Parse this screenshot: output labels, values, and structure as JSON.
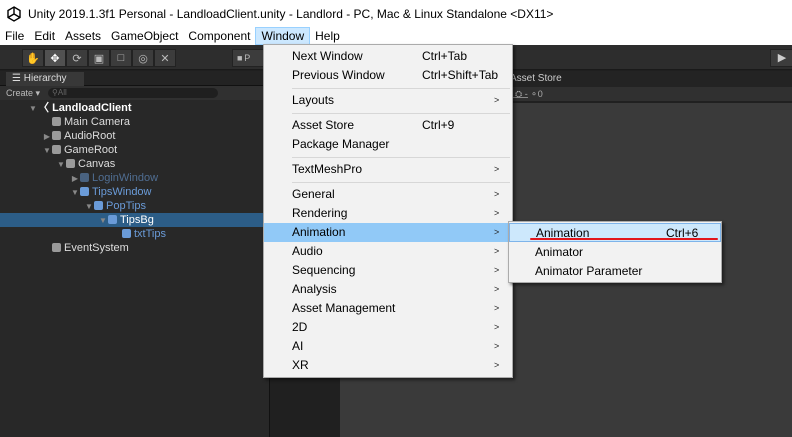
{
  "titlebar": {
    "title": "Unity 2019.1.3f1 Personal - LandloadClient.unity - Landlord - PC, Mac & Linux Standalone <DX11>"
  },
  "menubar": {
    "items": [
      "File",
      "Edit",
      "Assets",
      "GameObject",
      "Component",
      "Window",
      "Help"
    ],
    "active": "Window"
  },
  "toolbar": {
    "tools": [
      "hand-icon",
      "move-icon",
      "rotate-icon",
      "scale-icon",
      "rect-icon",
      "transform-icon",
      "custom-tool-icon"
    ],
    "active_tool": "move-icon",
    "pivot_label": "P",
    "play_icon": "play-icon"
  },
  "hierarchy": {
    "tab_label": "Hierarchy",
    "create_label": "Create",
    "search_placeholder": "All",
    "rows": [
      {
        "label": "LandloadClient",
        "depth": 1,
        "expanded": true,
        "kind": "scene"
      },
      {
        "label": "Main Camera",
        "depth": 2,
        "kind": "object"
      },
      {
        "label": "AudioRoot",
        "depth": 2,
        "expanded": false,
        "kind": "object"
      },
      {
        "label": "GameRoot",
        "depth": 2,
        "expanded": true,
        "kind": "object"
      },
      {
        "label": "Canvas",
        "depth": 3,
        "expanded": true,
        "kind": "object"
      },
      {
        "label": "LoginWindow",
        "depth": 4,
        "expanded": false,
        "kind": "prefab-inactive"
      },
      {
        "label": "TipsWindow",
        "depth": 4,
        "expanded": true,
        "kind": "prefab"
      },
      {
        "label": "PopTips",
        "depth": 5,
        "expanded": true,
        "kind": "prefab"
      },
      {
        "label": "TipsBg",
        "depth": 6,
        "expanded": true,
        "kind": "prefab",
        "selected": true
      },
      {
        "label": "txtTips",
        "depth": 7,
        "kind": "prefab"
      },
      {
        "label": "EventSystem",
        "depth": 2,
        "kind": "object"
      }
    ]
  },
  "scene": {
    "asset_store_tab": "Asset Store",
    "toolbar_text": "▸ ⛭ - ⚬0"
  },
  "window_menu": {
    "items": [
      {
        "label": "Next Window",
        "shortcut": "Ctrl+Tab"
      },
      {
        "label": "Previous Window",
        "shortcut": "Ctrl+Shift+Tab"
      },
      {
        "label": "Layouts",
        "submenu": true
      },
      {
        "label": "Asset Store",
        "shortcut": "Ctrl+9"
      },
      {
        "label": "Package Manager"
      },
      {
        "label": "TextMeshPro",
        "submenu": true
      },
      {
        "label": "General",
        "submenu": true
      },
      {
        "label": "Rendering",
        "submenu": true
      },
      {
        "label": "Animation",
        "submenu": true,
        "highlighted": true
      },
      {
        "label": "Audio",
        "submenu": true
      },
      {
        "label": "Sequencing",
        "submenu": true
      },
      {
        "label": "Analysis",
        "submenu": true
      },
      {
        "label": "Asset Management",
        "submenu": true
      },
      {
        "label": "2D",
        "submenu": true
      },
      {
        "label": "AI",
        "submenu": true
      },
      {
        "label": "XR",
        "submenu": true
      }
    ],
    "submenu_arrow": ">"
  },
  "animation_submenu": {
    "items": [
      {
        "label": "Animation",
        "shortcut": "Ctrl+6",
        "highlighted": true
      },
      {
        "label": "Animator"
      },
      {
        "label": "Animator Parameter"
      }
    ]
  },
  "colors": {
    "selection": "#2c5d87",
    "menu_highlight": "#91c9f7",
    "annotation_red": "#e2161b",
    "prefab_blue": "#6a9bd8"
  }
}
